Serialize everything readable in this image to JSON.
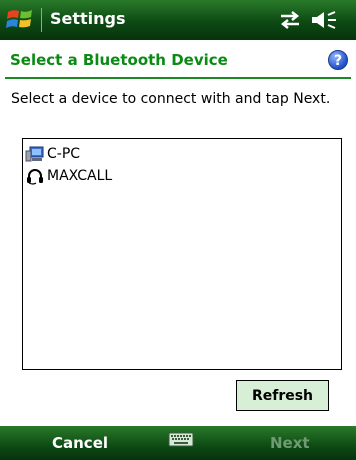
{
  "titlebar": {
    "app_title": "Settings",
    "start_icon": "windows-flag-icon",
    "connectivity_icon": "connectivity-arrows-icon",
    "volume_icon": "speaker-icon"
  },
  "header": {
    "title": "Select a Bluetooth Device",
    "help_icon": "help-icon",
    "help_glyph": "?"
  },
  "instruction": "Select a device to connect with and tap Next.",
  "devices": [
    {
      "label": "C-PC",
      "icon": "computer-icon"
    },
    {
      "label": "MAXCALL",
      "icon": "headset-icon"
    }
  ],
  "refresh_label": "Refresh",
  "menubar": {
    "left_softkey": "Cancel",
    "right_softkey": "Next",
    "keyboard_icon": "keyboard-icon"
  },
  "colors": {
    "titlebar_green": "#0d4a14",
    "header_text_green": "#0b8a14",
    "refresh_bg": "#d6efd6",
    "disabled_softkey": "#6e9b72"
  }
}
